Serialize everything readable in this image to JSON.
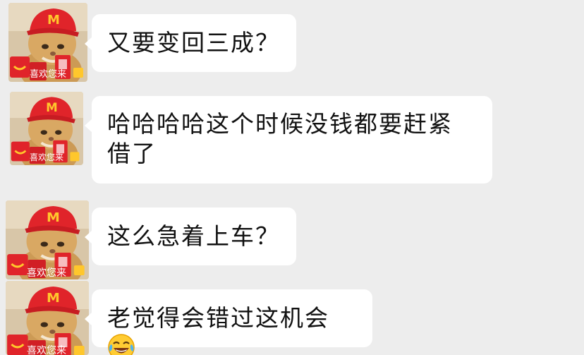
{
  "messages": [
    {
      "sender": "contact",
      "text": "又要变回三成？",
      "avatar_caption": "喜欢您来"
    },
    {
      "sender": "contact",
      "text": "哈哈哈哈这个时候没钱都要赶紧借了",
      "avatar_caption": "喜欢您来"
    },
    {
      "sender": "contact",
      "text": "这么急着上车？",
      "avatar_caption": "喜欢您来"
    },
    {
      "sender": "contact",
      "text": "老觉得会错过这机会",
      "emoji": "laughing-crying-emoji",
      "avatar_caption": "喜欢您来"
    }
  ],
  "colors": {
    "background": "#ededed",
    "bubble": "#ffffff",
    "text": "#111111",
    "hat_red": "#e0242a",
    "logo_yellow": "#ffc72c"
  }
}
